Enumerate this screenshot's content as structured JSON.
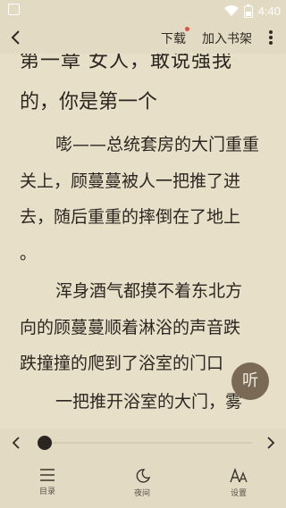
{
  "status_bar": {
    "time": "4:40"
  },
  "toolbar": {
    "download": "下载",
    "add_shelf": "加入书架"
  },
  "reader": {
    "cut_title": "第一章 女人，敢说强我",
    "title_line": "的，你是第一个",
    "paragraphs": [
      {
        "lines": [
          "嘭——总统套房的大门重重",
          "关上，顾蔓蔓被人一把推了进",
          "去，随后重重的摔倒在了地上",
          "。"
        ]
      },
      {
        "lines": [
          "浑身酒气都摸不着东北方",
          "向的顾蔓蔓顺着淋浴的声音跌",
          "跌撞撞的爬到了浴室的门口"
        ]
      },
      {
        "lines": [
          "一把推开浴室的大门，雾"
        ]
      }
    ]
  },
  "listen_button": "听",
  "progress": {
    "fraction": 0.0
  },
  "bottom_bar": {
    "toc": "目录",
    "night": "夜间",
    "settings": "设置"
  },
  "colors": {
    "page_bg": "#e8dfc9",
    "bar_bg": "#e3dac4",
    "listen_bg": "#7a6a55",
    "badge": "#e0523f"
  },
  "icons": [
    "back-icon",
    "more-vertical-icon",
    "prev-chapter-icon",
    "next-chapter-icon",
    "list-icon",
    "moon-icon",
    "text-settings-icon",
    "wifi-icon",
    "battery-icon"
  ]
}
